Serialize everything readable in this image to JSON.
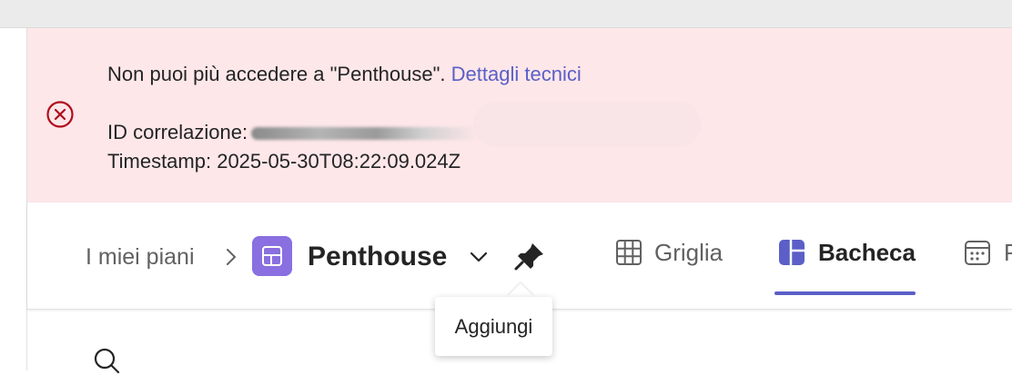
{
  "error_banner": {
    "message": "Non puoi più accedere a \"Penthouse\".",
    "details_link": "Dettagli tecnici",
    "correlation_label": "ID correlazione:",
    "timestamp": "Timestamp: 2025-05-30T08:22:09.024Z",
    "icon": "error-circle-icon"
  },
  "breadcrumb": {
    "root": "I miei piani",
    "separator_icon": "chevron-right-icon"
  },
  "plan": {
    "title": "Penthouse",
    "icon": "plan-icon",
    "dropdown_icon": "chevron-down-icon",
    "pin_icon": "pin-icon"
  },
  "tabs": [
    {
      "label": "Griglia",
      "icon": "grid-icon",
      "selected": false
    },
    {
      "label": "Bacheca",
      "icon": "board-icon",
      "selected": true
    },
    {
      "label": "P",
      "icon": "calendar-icon",
      "selected": false
    }
  ],
  "tooltip": {
    "text": "Aggiungi"
  },
  "toolbar": {
    "search_icon": "search-icon"
  },
  "colors": {
    "banner_bg": "#fde7e9",
    "error_red": "#b10e1c",
    "link": "#5b5fc7",
    "accent": "#5b5fc7",
    "plan_icon_bg": "#8a6fe0"
  }
}
